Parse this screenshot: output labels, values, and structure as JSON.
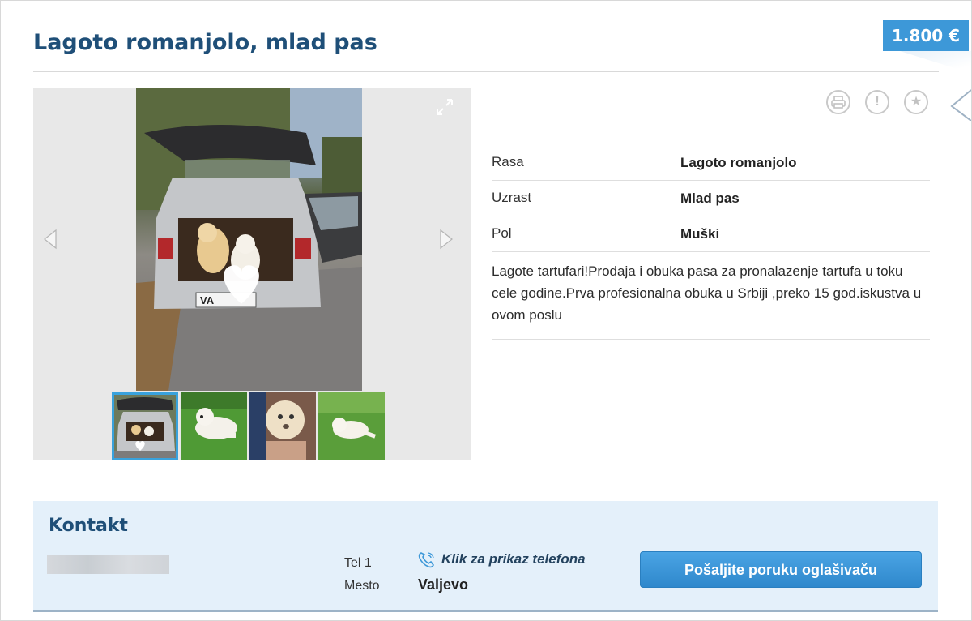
{
  "listing": {
    "title": "Lagoto romanjolo, mlad pas",
    "price": "1.800 €"
  },
  "gallery": {
    "plate_text": "VA",
    "thumbnail_count": 4,
    "active_thumbnail": 1
  },
  "details": {
    "rows": [
      {
        "label": "Rasa",
        "value": "Lagoto romanjolo"
      },
      {
        "label": "Uzrast",
        "value": "Mlad pas"
      },
      {
        "label": "Pol",
        "value": "Muški"
      }
    ],
    "description": "Lagote tartufari!Prodaja i obuka pasa za pronalazenje tartufa u toku cele godine.Prva profesionalna obuka u Srbiji ,preko 15 god.iskustva u ovom poslu"
  },
  "actions": {
    "print_icon": "printer-icon",
    "report_icon": "exclamation-icon",
    "favorite_icon": "star-icon"
  },
  "contact": {
    "heading": "Kontakt",
    "tel_label": "Tel 1",
    "phone_link": "Klik za prikaz telefona",
    "city_label": "Mesto",
    "city": "Valjevo",
    "message_button": "Pošaljite poruku oglašivaču"
  },
  "colors": {
    "title": "#1f4f78",
    "price_bg": "#3d98d8",
    "button": "#2f88cc",
    "contact_bg": "#e4f0fa",
    "thumb_active": "#39a2dc"
  }
}
